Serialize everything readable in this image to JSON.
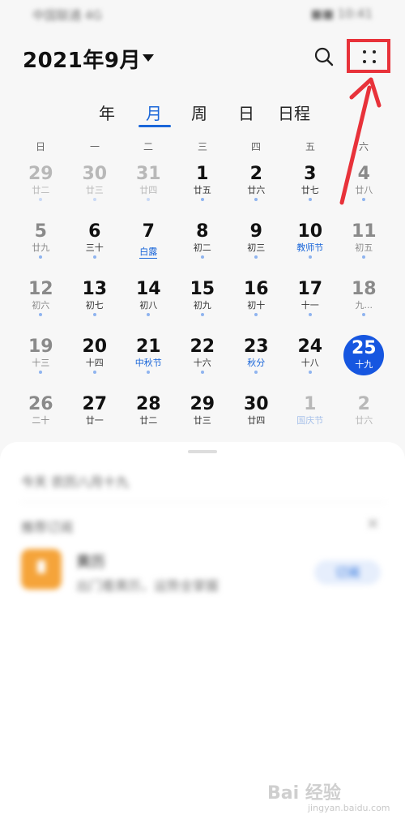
{
  "status_bar": {
    "left": "中国联通 4G",
    "right": "■■ 10:41"
  },
  "header": {
    "month_label": "2021年9月"
  },
  "view_tabs": [
    "年",
    "月",
    "周",
    "日",
    "日程"
  ],
  "active_tab": "月",
  "weekdays": [
    "日",
    "一",
    "二",
    "三",
    "四",
    "五",
    "六"
  ],
  "weeks": [
    [
      {
        "d": "29",
        "l": "廿二",
        "other": true,
        "dot": true
      },
      {
        "d": "30",
        "l": "廿三",
        "other": true,
        "dot": true
      },
      {
        "d": "31",
        "l": "廿四",
        "other": true,
        "dot": true
      },
      {
        "d": "1",
        "l": "廿五",
        "dot": true
      },
      {
        "d": "2",
        "l": "廿六",
        "dot": true
      },
      {
        "d": "3",
        "l": "廿七",
        "dot": true
      },
      {
        "d": "4",
        "l": "廿八",
        "weekend": true,
        "dot": true
      }
    ],
    [
      {
        "d": "5",
        "l": "廿九",
        "weekend": true,
        "dot": true
      },
      {
        "d": "6",
        "l": "三十",
        "dot": true
      },
      {
        "d": "7",
        "l": "白露",
        "festival": true,
        "underline": true
      },
      {
        "d": "8",
        "l": "初二",
        "dot": true
      },
      {
        "d": "9",
        "l": "初三",
        "dot": true
      },
      {
        "d": "10",
        "l": "教师节",
        "festival": true,
        "dot": true
      },
      {
        "d": "11",
        "l": "初五",
        "weekend": true,
        "dot": true
      }
    ],
    [
      {
        "d": "12",
        "l": "初六",
        "weekend": true,
        "dot": true
      },
      {
        "d": "13",
        "l": "初七",
        "dot": true
      },
      {
        "d": "14",
        "l": "初八",
        "dot": true
      },
      {
        "d": "15",
        "l": "初九",
        "dot": true
      },
      {
        "d": "16",
        "l": "初十",
        "dot": true
      },
      {
        "d": "17",
        "l": "十一",
        "dot": true
      },
      {
        "d": "18",
        "l": "九...",
        "weekend": true,
        "festival": true,
        "dot": true
      }
    ],
    [
      {
        "d": "19",
        "l": "十三",
        "weekend": true,
        "dot": true
      },
      {
        "d": "20",
        "l": "十四",
        "dot": true
      },
      {
        "d": "21",
        "l": "中秋节",
        "festival": true,
        "dot": true
      },
      {
        "d": "22",
        "l": "十六",
        "dot": true
      },
      {
        "d": "23",
        "l": "秋分",
        "festival": true,
        "dot": true
      },
      {
        "d": "24",
        "l": "十八",
        "dot": true
      },
      {
        "d": "25",
        "l": "十九",
        "today": true
      }
    ],
    [
      {
        "d": "26",
        "l": "二十",
        "weekend": true
      },
      {
        "d": "27",
        "l": "廿一"
      },
      {
        "d": "28",
        "l": "廿二"
      },
      {
        "d": "29",
        "l": "廿三"
      },
      {
        "d": "30",
        "l": "廿四"
      },
      {
        "d": "1",
        "l": "国庆节",
        "other": true,
        "festival": true
      },
      {
        "d": "2",
        "l": "廿六",
        "other": true
      }
    ]
  ],
  "sheet": {
    "today_lunar": "今天 农历八月十九",
    "recommend_title": "推荐订阅",
    "recommend_close": "×",
    "app_name": "黄历",
    "app_desc": "出门看黄历，运势全掌握",
    "subscribe_label": "订阅"
  },
  "watermark": {
    "logo": "Bai 经验",
    "url": "jingyan.baidu.com"
  },
  "colors": {
    "accent": "#1a66d9",
    "today": "#1656e0",
    "highlight_box": "#e8323a"
  }
}
